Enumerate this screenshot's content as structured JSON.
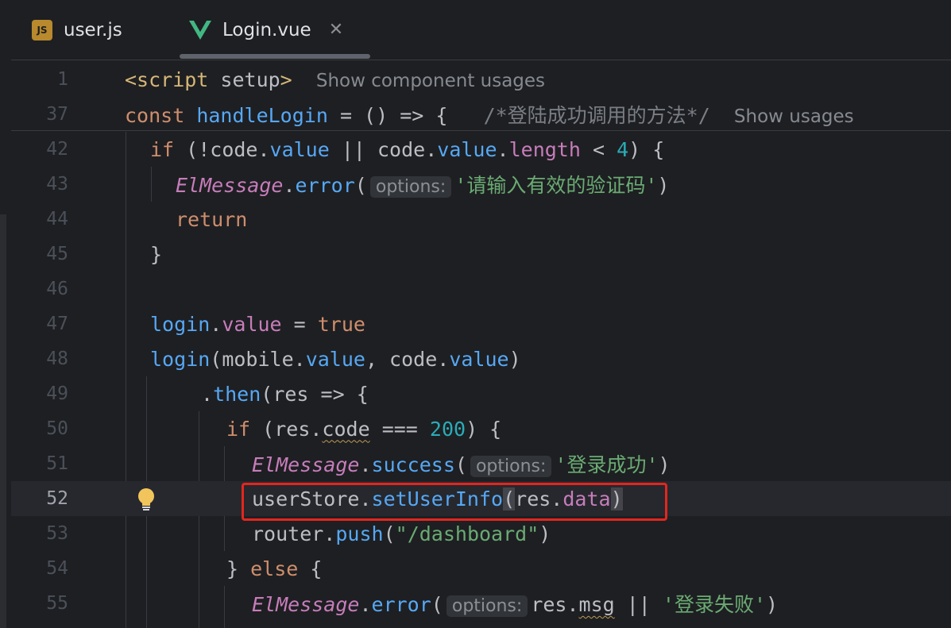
{
  "tabs": [
    {
      "label": "user.js",
      "icon": "js-file-icon",
      "icon_text": "JS"
    },
    {
      "label": "Login.vue",
      "icon": "vue-file-icon",
      "active": true,
      "close_glyph": "✕"
    }
  ],
  "sticky": {
    "line1": {
      "num": "1",
      "text": "<script setup>",
      "hint": "Show component usages"
    },
    "line37": {
      "num": "37",
      "comment": "/*登陆成功调用的方法*/",
      "hint": "Show usages"
    }
  },
  "code": {
    "l42": "42",
    "l43": "43",
    "l44": "44",
    "l45": "45",
    "l46": "46",
    "l47": "47",
    "l48": "48",
    "l49": "49",
    "l50": "50",
    "l51": "51",
    "l52": "52",
    "l53": "53",
    "l54": "54",
    "l55": "55",
    "inlay_options": "options:",
    "str_invalid_code": "'请输入有效的验证码'",
    "str_login_success": "'登录成功'",
    "str_dashboard": "\"/dashboard\"",
    "str_login_failed": "'登录失败'"
  },
  "colors": {
    "background": "#1e1f22",
    "keyword": "#cf8e6d",
    "function": "#56a8f5",
    "property": "#c77dbb",
    "string": "#6aab73",
    "number": "#2aacb8",
    "highlight_box": "#e3261f"
  }
}
